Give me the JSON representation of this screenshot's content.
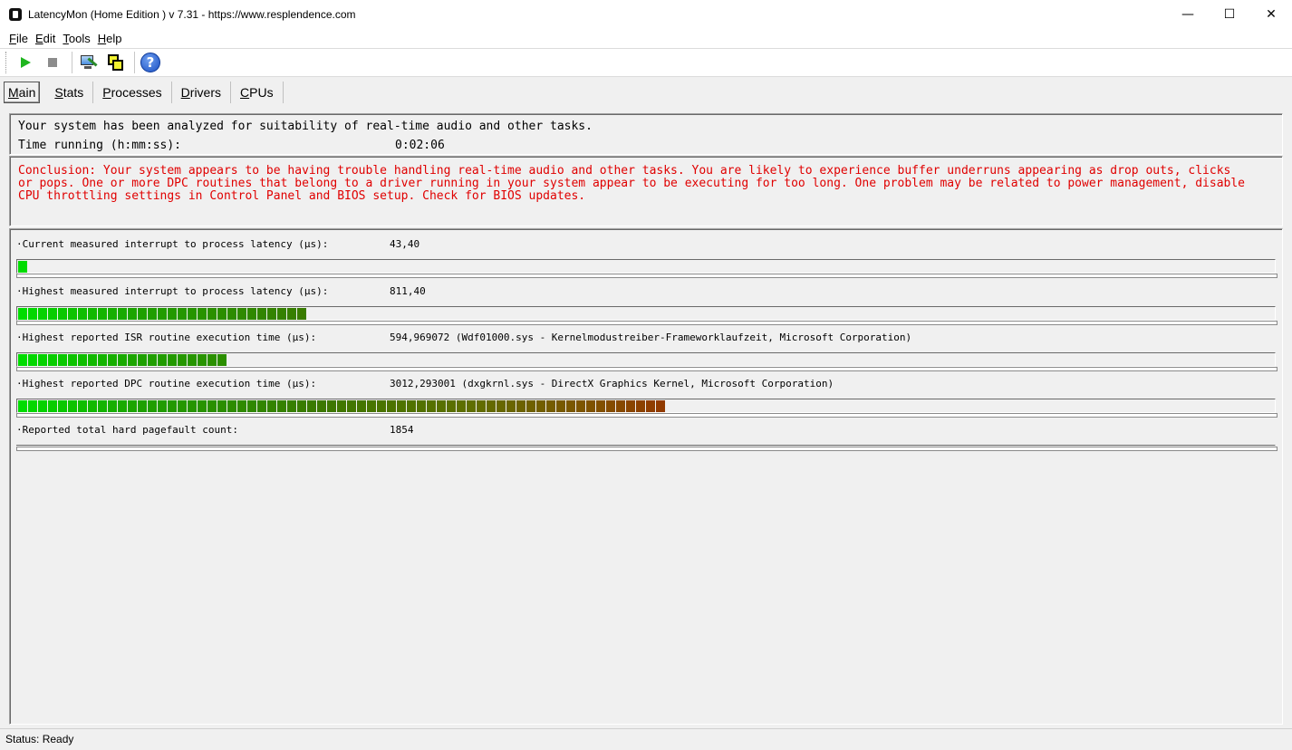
{
  "window": {
    "title": "LatencyMon  (Home Edition )  v 7.31 - https://www.resplendence.com",
    "minimize": "—",
    "maximize": "☐",
    "close": "✕"
  },
  "menu": [
    {
      "label": "File",
      "key": "F",
      "rest": "ile"
    },
    {
      "label": "Edit",
      "key": "E",
      "rest": "dit"
    },
    {
      "label": "Tools",
      "key": "T",
      "rest": "ools"
    },
    {
      "label": "Help",
      "key": "H",
      "rest": "elp"
    }
  ],
  "toolbar": {
    "start_icon": "play-icon",
    "stop_icon": "stop-icon",
    "analyze_icon": "monitor-wand-icon",
    "cpu_icon": "cpu-windows-icon",
    "help_icon": "help-icon",
    "help_glyph": "?"
  },
  "tabs": [
    {
      "key": "M",
      "rest": "ain",
      "active": true
    },
    {
      "key": "S",
      "rest": "tats",
      "active": false
    },
    {
      "key": "P",
      "rest": "rocesses",
      "active": false
    },
    {
      "key": "D",
      "rest": "rivers",
      "active": false
    },
    {
      "key": "C",
      "rest": "PUs",
      "active": false
    }
  ],
  "summary": {
    "analyzed_text": "Your system has been analyzed for suitability of real-time audio and other tasks.",
    "time_label": "Time running (h:mm:ss):",
    "time_value": "0:02:06"
  },
  "conclusion": {
    "color": "#e00000",
    "text": "Conclusion: Your system appears to be having trouble handling real-time audio and other tasks. You are likely to experience buffer underruns appearing as drop outs, clicks\nor pops. One or more DPC routines that belong to a driver running in your system appear to be executing for too long. One problem may be related to power management, disable\nCPU throttling settings in Control Panel and BIOS setup. Check for BIOS updates."
  },
  "metrics": [
    {
      "label": "·Current measured interrupt to process latency (µs):",
      "value": "43,40",
      "filled_segments": 1,
      "total_segments": 126
    },
    {
      "label": "·Highest measured interrupt to process latency (µs):",
      "value": "811,40",
      "filled_segments": 29,
      "total_segments": 126
    },
    {
      "label": "·Highest reported ISR routine execution time (µs):",
      "value": "594,969072  (Wdf01000.sys - Kernelmodustreiber-Frameworklaufzeit, Microsoft Corporation)",
      "filled_segments": 21,
      "total_segments": 126
    },
    {
      "label": "·Highest reported DPC routine execution time (µs):",
      "value": "3012,293001  (dxgkrnl.sys - DirectX Graphics Kernel, Microsoft Corporation)",
      "filled_segments": 65,
      "total_segments": 126
    },
    {
      "label": "·Reported total hard pagefault count:",
      "value": "1854",
      "filled_segments": 0,
      "total_segments": 126
    }
  ],
  "status": "Status: Ready"
}
